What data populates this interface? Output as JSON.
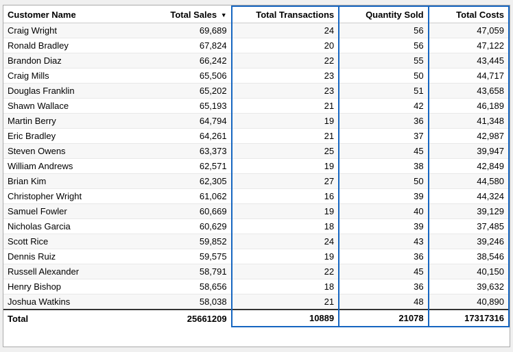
{
  "header": {
    "col_name": "Customer Name",
    "col_sales": "Total Sales",
    "col_transactions": "Total Transactions",
    "col_quantity": "Quantity Sold",
    "col_costs": "Total Costs"
  },
  "rows": [
    {
      "name": "Craig Wright",
      "sales": 69689,
      "transactions": 24,
      "quantity": 56,
      "costs": 47059
    },
    {
      "name": "Ronald Bradley",
      "sales": 67824,
      "transactions": 20,
      "quantity": 56,
      "costs": 47122
    },
    {
      "name": "Brandon Diaz",
      "sales": 66242,
      "transactions": 22,
      "quantity": 55,
      "costs": 43445
    },
    {
      "name": "Craig Mills",
      "sales": 65506,
      "transactions": 23,
      "quantity": 50,
      "costs": 44717
    },
    {
      "name": "Douglas Franklin",
      "sales": 65202,
      "transactions": 23,
      "quantity": 51,
      "costs": 43658
    },
    {
      "name": "Shawn Wallace",
      "sales": 65193,
      "transactions": 21,
      "quantity": 42,
      "costs": 46189
    },
    {
      "name": "Martin Berry",
      "sales": 64794,
      "transactions": 19,
      "quantity": 36,
      "costs": 41348
    },
    {
      "name": "Eric Bradley",
      "sales": 64261,
      "transactions": 21,
      "quantity": 37,
      "costs": 42987
    },
    {
      "name": "Steven Owens",
      "sales": 63373,
      "transactions": 25,
      "quantity": 45,
      "costs": 39947
    },
    {
      "name": "William Andrews",
      "sales": 62571,
      "transactions": 19,
      "quantity": 38,
      "costs": 42849
    },
    {
      "name": "Brian Kim",
      "sales": 62305,
      "transactions": 27,
      "quantity": 50,
      "costs": 44580
    },
    {
      "name": "Christopher Wright",
      "sales": 61062,
      "transactions": 16,
      "quantity": 39,
      "costs": 44324
    },
    {
      "name": "Samuel Fowler",
      "sales": 60669,
      "transactions": 19,
      "quantity": 40,
      "costs": 39129
    },
    {
      "name": "Nicholas Garcia",
      "sales": 60629,
      "transactions": 18,
      "quantity": 39,
      "costs": 37485
    },
    {
      "name": "Scott Rice",
      "sales": 59852,
      "transactions": 24,
      "quantity": 43,
      "costs": 39246
    },
    {
      "name": "Dennis Ruiz",
      "sales": 59575,
      "transactions": 19,
      "quantity": 36,
      "costs": 38546
    },
    {
      "name": "Russell Alexander",
      "sales": 58791,
      "transactions": 22,
      "quantity": 45,
      "costs": 40150
    },
    {
      "name": "Henry Bishop",
      "sales": 58656,
      "transactions": 18,
      "quantity": 36,
      "costs": 39632
    },
    {
      "name": "Joshua Watkins",
      "sales": 58038,
      "transactions": 21,
      "quantity": 48,
      "costs": 40890
    }
  ],
  "footer": {
    "label": "Total",
    "sales": "25661209",
    "transactions": "10889",
    "quantity": "21078",
    "costs": "17317316"
  }
}
